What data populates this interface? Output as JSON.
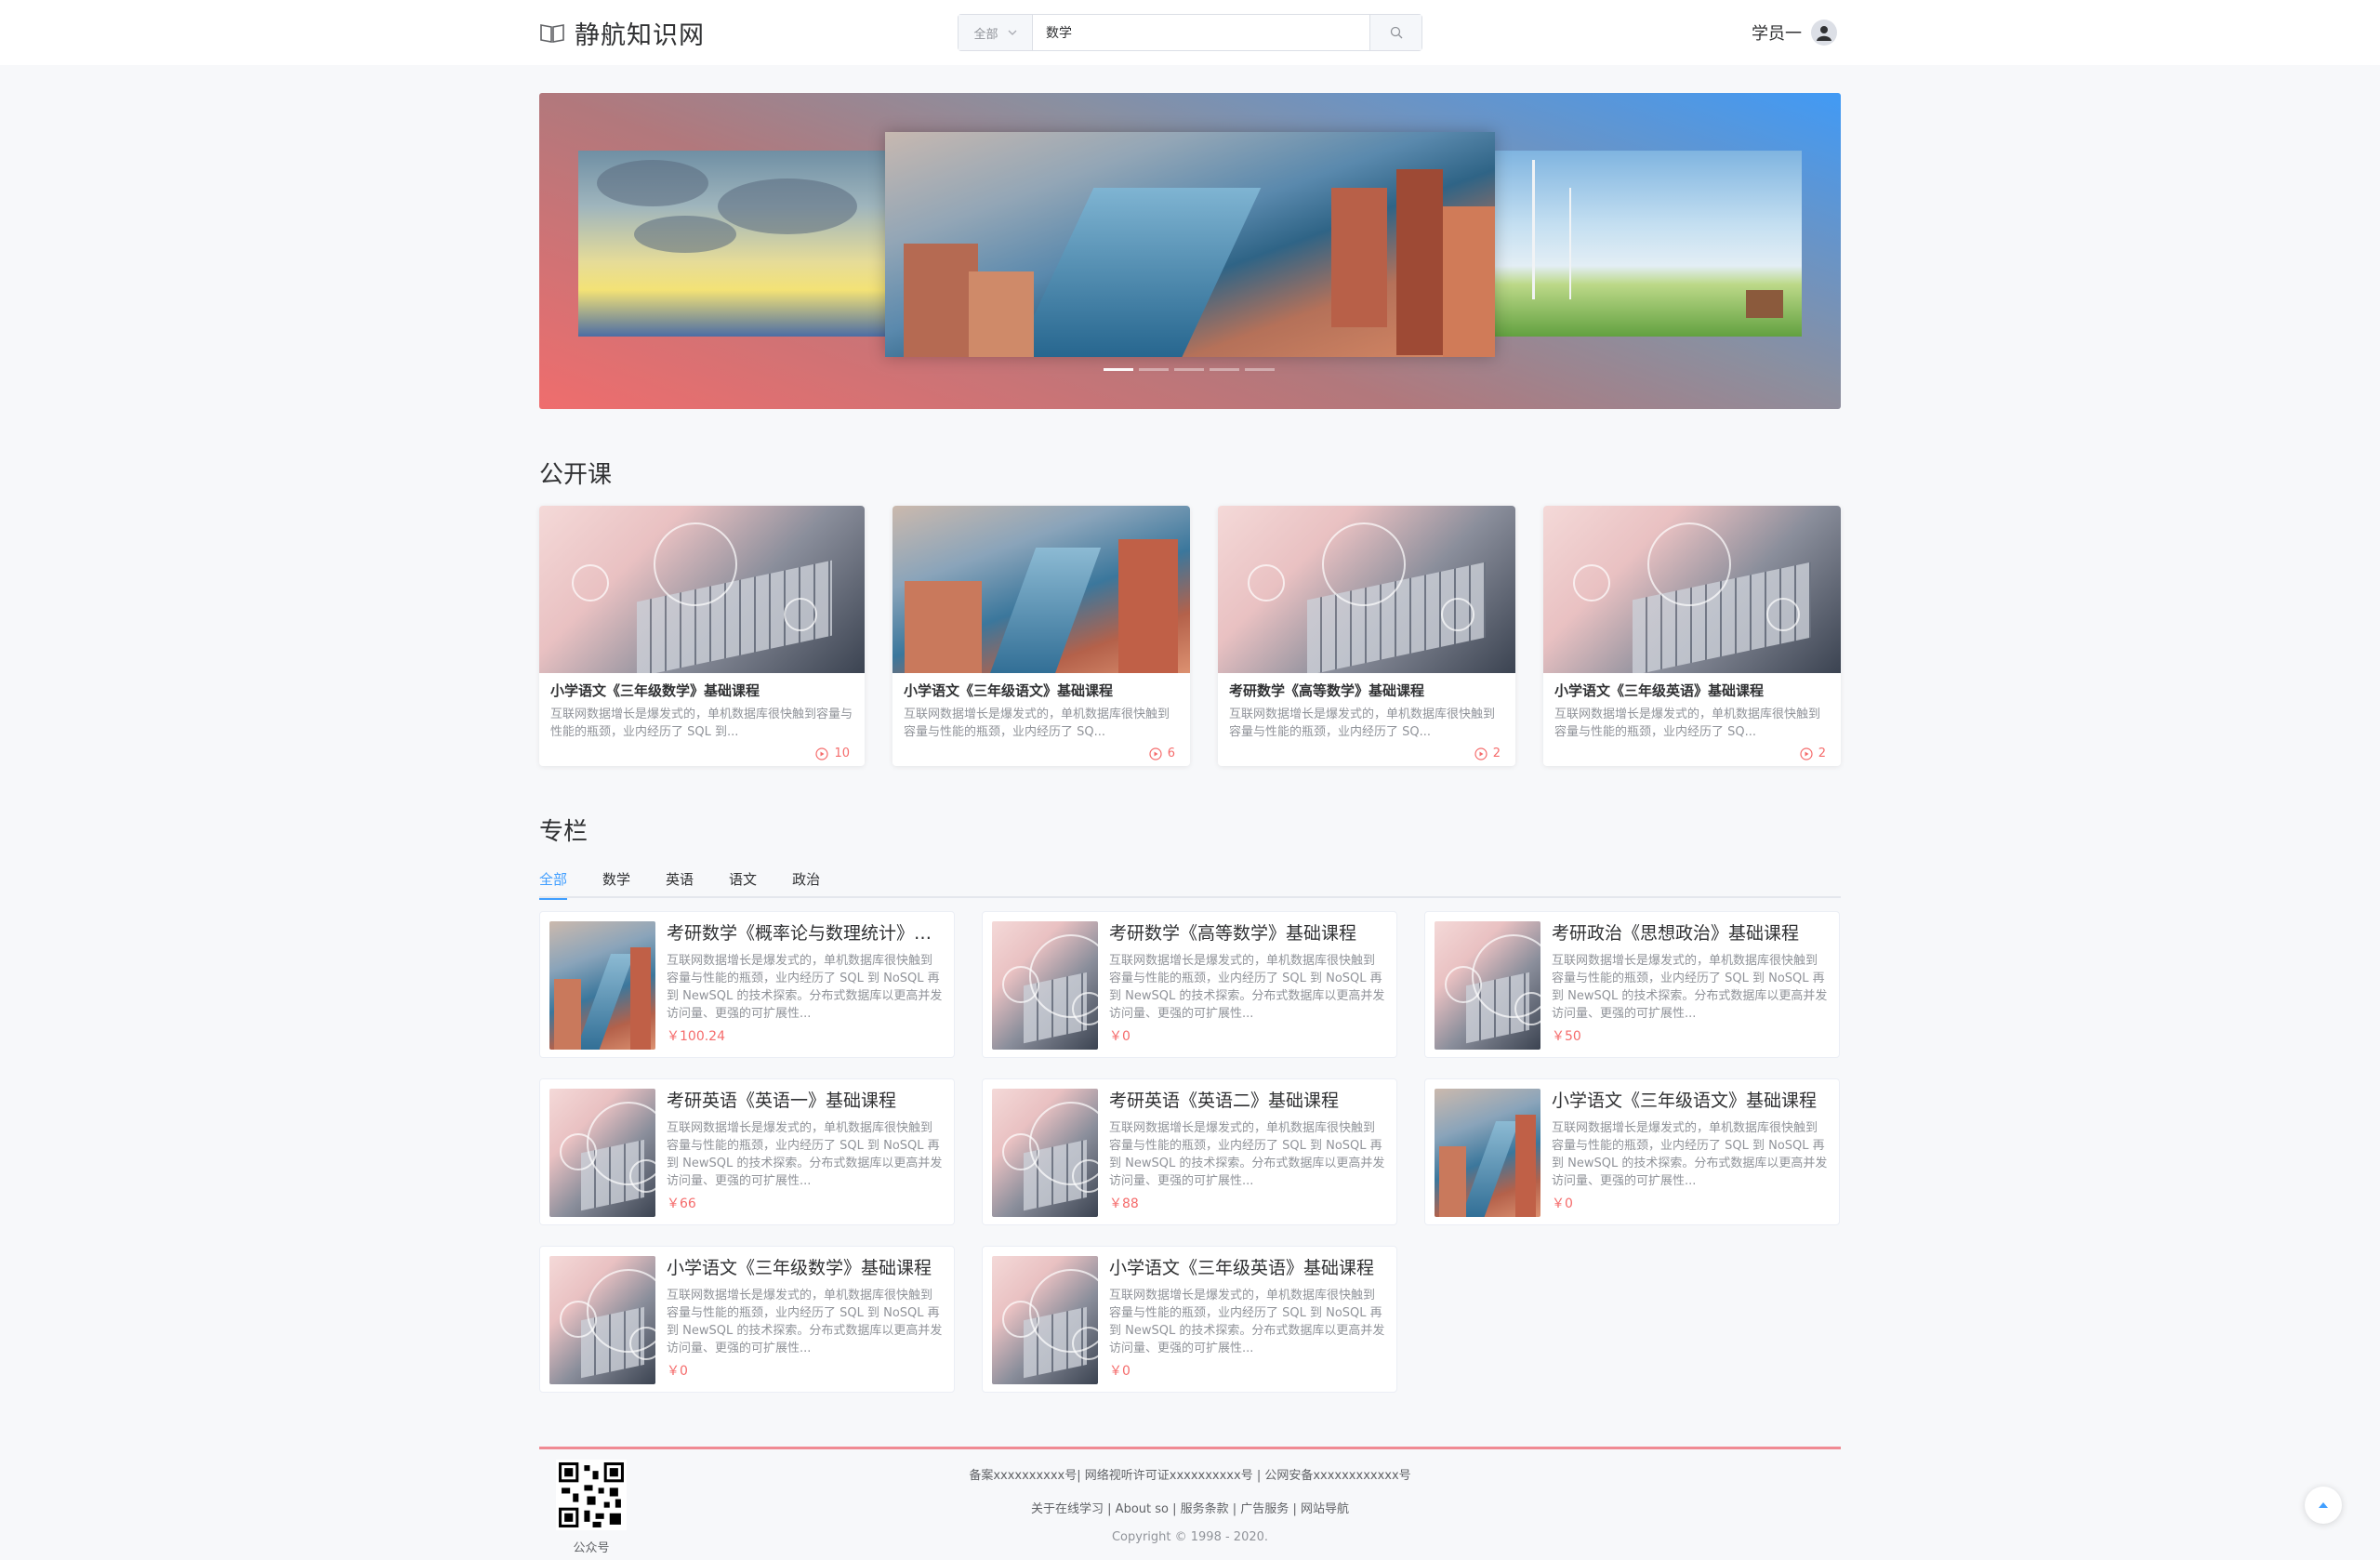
{
  "header": {
    "logo_text": "静航知识网",
    "search_category": "全部",
    "search_value": "数学",
    "user_name": "学员一"
  },
  "banner": {
    "slide_count": 5,
    "active_slide": 1
  },
  "open_courses": {
    "title": "公开课",
    "items": [
      {
        "title": "小学语文《三年级数学》基础课程",
        "desc": "互联网数据增长是爆发式的，单机数据库很快触到容量与性能的瓶颈，业内经历了 SQL 到...",
        "count": "10",
        "thumb": "laptop"
      },
      {
        "title": "小学语文《三年级语文》基础课程",
        "desc": "互联网数据增长是爆发式的，单机数据库很快触到容量与性能的瓶颈，业内经历了 SQ...",
        "count": "6",
        "thumb": "city"
      },
      {
        "title": "考研数学《高等数学》基础课程",
        "desc": "互联网数据增长是爆发式的，单机数据库很快触到容量与性能的瓶颈，业内经历了 SQ...",
        "count": "2",
        "thumb": "laptop"
      },
      {
        "title": "小学语文《三年级英语》基础课程",
        "desc": "互联网数据增长是爆发式的，单机数据库很快触到容量与性能的瓶颈，业内经历了 SQ...",
        "count": "2",
        "thumb": "laptop"
      }
    ]
  },
  "columns": {
    "title": "专栏",
    "tabs": [
      "全部",
      "数学",
      "英语",
      "语文",
      "政治"
    ],
    "active_tab": 0,
    "items": [
      {
        "title": "考研数学《概率论与数理统计》基础课程",
        "desc": "互联网数据增长是爆发式的，单机数据库很快触到容量与性能的瓶颈，业内经历了 SQL 到 NoSQL 再到 NewSQL 的技术探索。分布式数据库以更高并发访问量、更强的可扩展性...",
        "price": "￥100.24",
        "thumb": "city"
      },
      {
        "title": "考研数学《高等数学》基础课程",
        "desc": "互联网数据增长是爆发式的，单机数据库很快触到容量与性能的瓶颈，业内经历了 SQL 到 NoSQL 再到 NewSQL 的技术探索。分布式数据库以更高并发访问量、更强的可扩展性...",
        "price": "￥0",
        "thumb": "laptop"
      },
      {
        "title": "考研政治《思想政治》基础课程",
        "desc": "互联网数据增长是爆发式的，单机数据库很快触到容量与性能的瓶颈，业内经历了 SQL 到 NoSQL 再到 NewSQL 的技术探索。分布式数据库以更高并发访问量、更强的可扩展性...",
        "price": "￥50",
        "thumb": "laptop"
      },
      {
        "title": "考研英语《英语一》基础课程",
        "desc": "互联网数据增长是爆发式的，单机数据库很快触到容量与性能的瓶颈，业内经历了 SQL 到 NoSQL 再到 NewSQL 的技术探索。分布式数据库以更高并发访问量、更强的可扩展性...",
        "price": "￥66",
        "thumb": "laptop"
      },
      {
        "title": "考研英语《英语二》基础课程",
        "desc": "互联网数据增长是爆发式的，单机数据库很快触到容量与性能的瓶颈，业内经历了 SQL 到 NoSQL 再到 NewSQL 的技术探索。分布式数据库以更高并发访问量、更强的可扩展性...",
        "price": "￥88",
        "thumb": "laptop"
      },
      {
        "title": "小学语文《三年级语文》基础课程",
        "desc": "互联网数据增长是爆发式的，单机数据库很快触到容量与性能的瓶颈，业内经历了 SQL 到 NoSQL 再到 NewSQL 的技术探索。分布式数据库以更高并发访问量、更强的可扩展性...",
        "price": "￥0",
        "thumb": "city"
      },
      {
        "title": "小学语文《三年级数学》基础课程",
        "desc": "互联网数据增长是爆发式的，单机数据库很快触到容量与性能的瓶颈，业内经历了 SQL 到 NoSQL 再到 NewSQL 的技术探索。分布式数据库以更高并发访问量、更强的可扩展性...",
        "price": "￥0",
        "thumb": "laptop"
      },
      {
        "title": "小学语文《三年级英语》基础课程",
        "desc": "互联网数据增长是爆发式的，单机数据库很快触到容量与性能的瓶颈，业内经历了 SQL 到 NoSQL 再到 NewSQL 的技术探索。分布式数据库以更高并发访问量、更强的可扩展性...",
        "price": "￥0",
        "thumb": "laptop"
      }
    ]
  },
  "footer": {
    "registration": "备案xxxxxxxxxx号| 网络视听许可证xxxxxxxxxx号 | 公网安备xxxxxxxxxxxx号",
    "links": [
      "关于在线学习",
      "About so",
      "服务条款",
      "广告服务",
      "网站导航"
    ],
    "copyright": "Copyright © 1998 - 2020.",
    "qr_label": "公众号"
  },
  "colors": {
    "primary": "#409eff",
    "price": "#f56c6c",
    "footer_line": "#f08a93"
  }
}
